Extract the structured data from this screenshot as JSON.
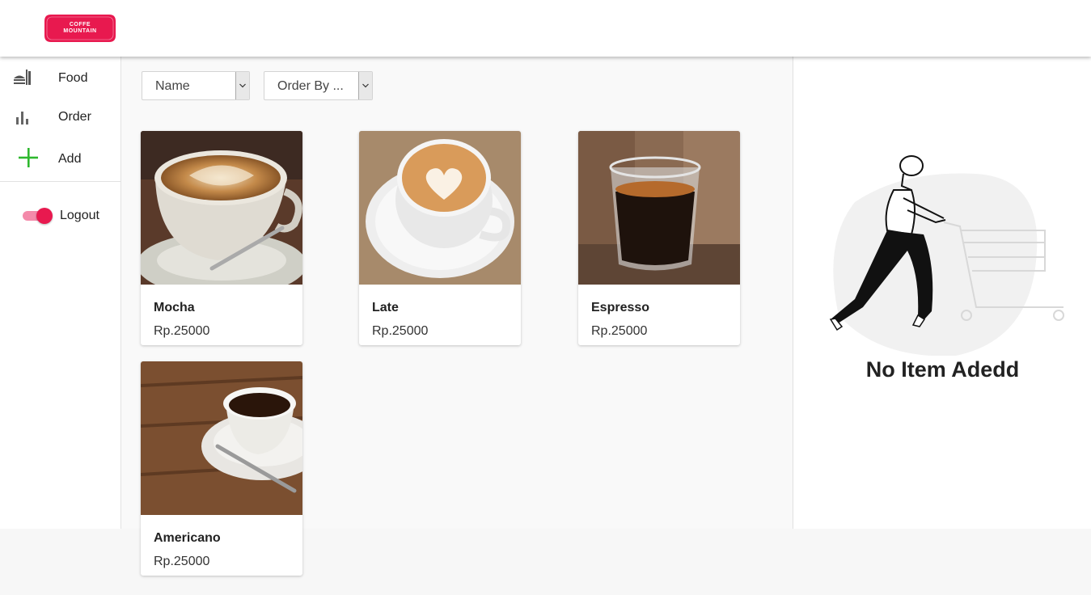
{
  "brand": {
    "line1": "COFFE",
    "line2": "MOUNTAIN",
    "color": "#e8194f"
  },
  "sidebar": {
    "items": [
      {
        "label": "Food",
        "icon": "food-icon"
      },
      {
        "label": "Order",
        "icon": "bar-chart-icon"
      },
      {
        "label": "Add",
        "icon": "plus-icon"
      }
    ],
    "logout_label": "Logout",
    "toggle_on": true
  },
  "filters": {
    "sort_field": "Name",
    "order_by": "Order By ..."
  },
  "products": [
    {
      "name": "Mocha",
      "price": "Rp.25000"
    },
    {
      "name": "Late",
      "price": "Rp.25000"
    },
    {
      "name": "Espresso",
      "price": "Rp.25000"
    },
    {
      "name": "Americano",
      "price": "Rp.25000"
    }
  ],
  "cart": {
    "empty_text": "No Item Adedd"
  },
  "colors": {
    "accent": "#e8194f",
    "add_green": "#2eb82e"
  }
}
